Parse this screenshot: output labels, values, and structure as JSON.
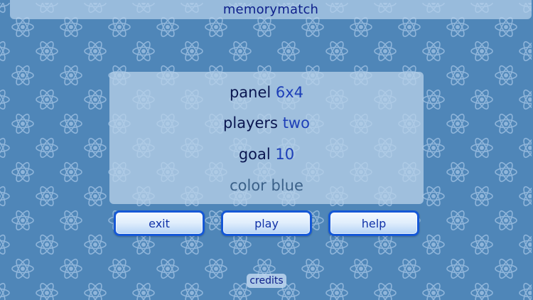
{
  "header": {
    "title": "memorymatch"
  },
  "settings": {
    "panel": {
      "label": "panel",
      "value": "6x4"
    },
    "players": {
      "label": "players",
      "value": "two"
    },
    "goal": {
      "label": "goal",
      "value": "10"
    },
    "color": {
      "label": "color",
      "value": "blue"
    }
  },
  "buttons": {
    "exit": "exit",
    "play": "play",
    "help": "help",
    "credits": "credits"
  },
  "background": {
    "pattern_icon": "atom-icon",
    "colors": {
      "base": "#4f86b8",
      "pattern": "#8fb5da",
      "accent": "#1558d6",
      "title_text": "#0d1f8a"
    }
  }
}
